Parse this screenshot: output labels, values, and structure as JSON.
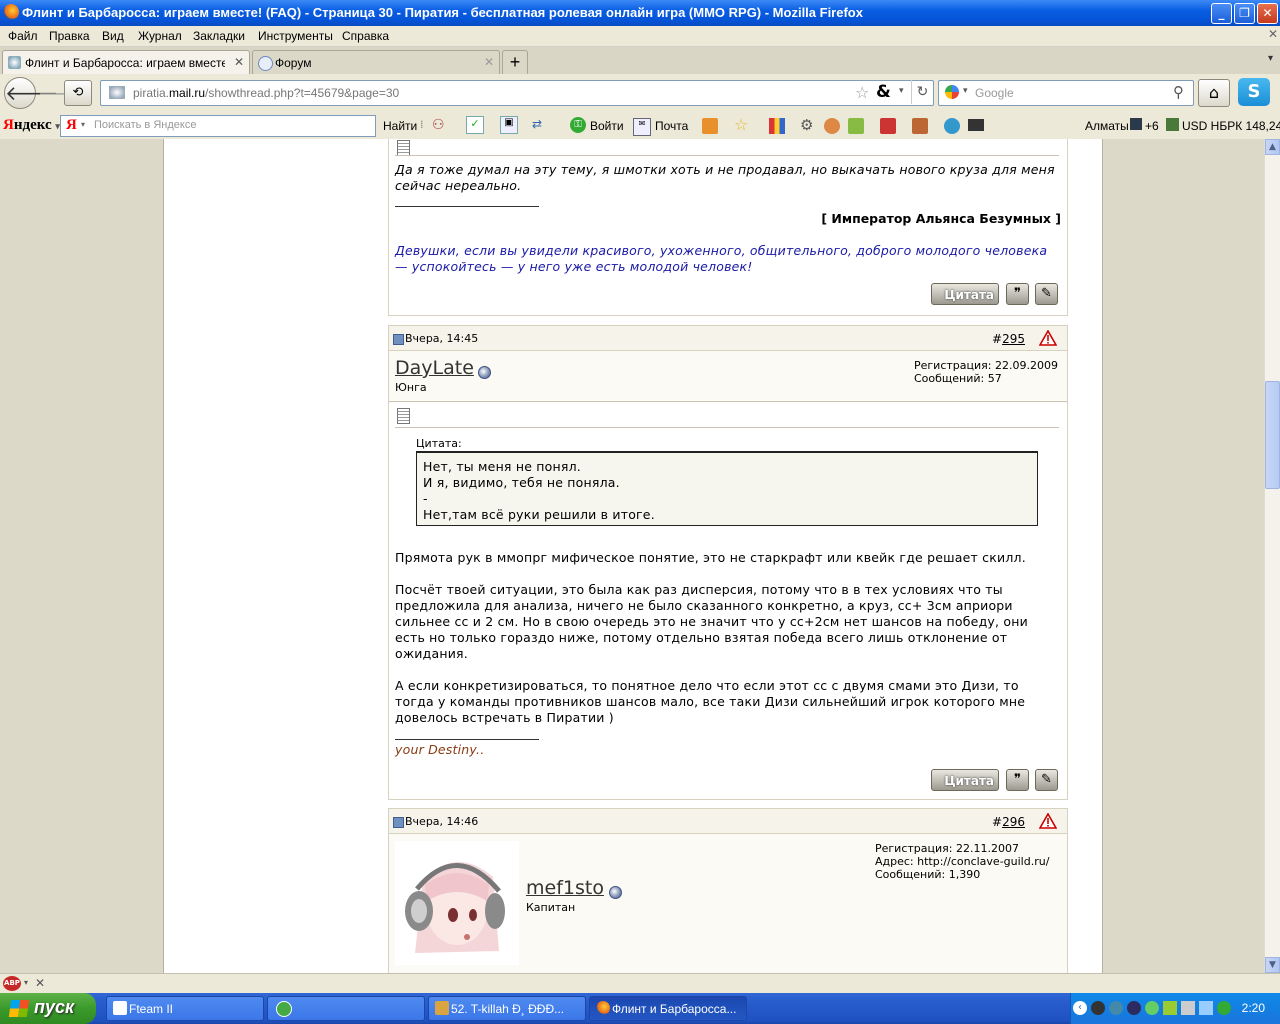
{
  "window": {
    "title": "Флинт и Барбаросса: играем вместе! (FAQ) - Страница 30 - Пиратия - бесплатная ролевая онлайн игра (MMO RPG) - Mozilla Firefox"
  },
  "menubar": {
    "items": [
      "Файл",
      "Правка",
      "Вид",
      "Журнал",
      "Закладки",
      "Инструменты",
      "Справка"
    ]
  },
  "tabs": [
    {
      "label": "Флинт и Барбаросса: играем вместе! (..."
    },
    {
      "label": "Форум"
    }
  ],
  "navbar": {
    "url_host": "piratia.",
    "url_domain": "mail.ru",
    "url_path": "/showthread.php?t=45679&page=30",
    "search_placeholder": "Google"
  },
  "yandex_bar": {
    "logo_first": "Я",
    "logo_rest": "ндекс",
    "search_placeholder": "Поискать в Яндексе",
    "find_label": "Найти",
    "login_label": "Войти",
    "mail_label": "Почта",
    "city": "Алматы",
    "temp": "+6",
    "currency": "USD НБРК 148,24"
  },
  "posts": [
    {
      "text": "Да я тоже думал на эту тему, я шмотки хоть и не продавал, но выкачать нового круза для меня сейчас нереально.",
      "signature_title": "[ Император Альянса Безумных ]",
      "signature_quote": "Девушки, если вы увидели красивого, ухоженного, общительного, доброго молодого человека — успокойтесь — у него уже есть молодой человек!",
      "quote_button": "Цитата"
    },
    {
      "date": "Вчера, 14:45",
      "num_prefix": "#",
      "num": "295",
      "username": "DayLate",
      "rank": "Юнга",
      "reg": "Регистрация: 22.09.2009",
      "msgs": "Сообщений: 57",
      "quote_label": "Цитата:",
      "quote_lines": [
        "Нет, ты меня не понял.",
        "И я, видимо, тебя не поняла.",
        "-",
        "Нет,там всё руки решили в итоге."
      ],
      "para1": "Прямота рук в ммопрг мифическое понятие, это не старкрафт или квейк где решает скилл.",
      "para2": "Посчёт твоей ситуации, это была как раз дисперсия, потому что в в тех условиях что ты предложила для анализа, ничего не было сказанного конкретно, а круз, сс+ 3см априори сильнее сс и 2 см. Но в свою очередь это не значит что у сс+2см нет шансов на победу, они есть но только гораздо ниже, потому отдельно взятая победа всего лишь отклонение от ожидания.",
      "para3": "А если конкретизироваться, то понятное дело что если этот сс с двумя смами это Дизи, то тогда у команды противников шансов мало, все таки Дизи сильнейший игрок которого мне довелось встречать в Пиратии )",
      "signature": "your Destiny..",
      "quote_button": "Цитата"
    },
    {
      "date": "Вчера, 14:46",
      "num_prefix": "#",
      "num": "296",
      "username": "mef1sto",
      "rank": "Капитан",
      "reg": "Регистрация: 22.11.2007",
      "addr": "Адрес: http://conclave-guild.ru/",
      "msgs": "Сообщений: 1,390"
    }
  ],
  "taskbar": {
    "start": "пуск",
    "tasks": [
      {
        "label": "Fteam II"
      },
      {
        "label": ""
      },
      {
        "label": "52. T-killah Ð¸ ÐÐÐ..."
      },
      {
        "label": "Флинт и Барбаросса..."
      }
    ],
    "clock": "2:20"
  },
  "colors": {
    "accent": "#0a5ee3",
    "link_blue": "#1a1aa6",
    "signature_brown": "#8a3a12"
  }
}
